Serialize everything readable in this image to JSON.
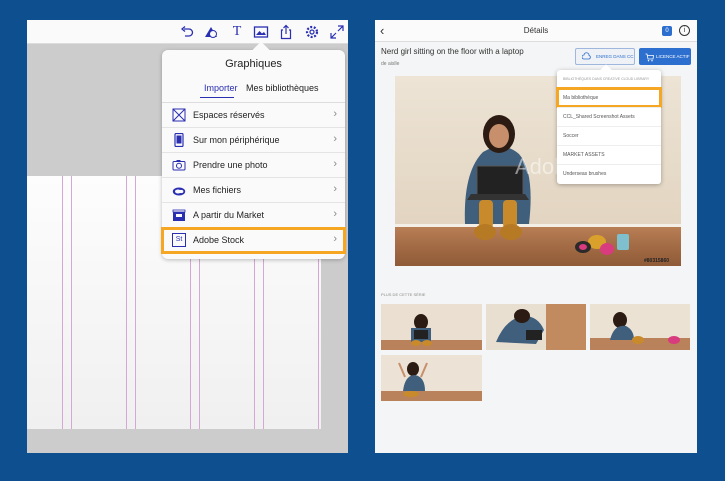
{
  "left_panel": {
    "toolbar": {
      "icons": [
        "undo-icon",
        "shapes-icon",
        "text-icon",
        "image-icon",
        "share-icon",
        "settings-icon",
        "expand-icon"
      ],
      "text_tool_glyph": "T"
    },
    "popover": {
      "title": "Graphiques",
      "segments": [
        "Importer",
        "Mes bibliothèques"
      ],
      "active_segment": "Importer",
      "items": [
        {
          "label": "Espaces réservés",
          "icon": "placeholder-icon"
        },
        {
          "label": "Sur mon périphérique",
          "icon": "device-icon"
        },
        {
          "label": "Prendre une photo",
          "icon": "camera-icon"
        },
        {
          "label": "Mes fichiers",
          "icon": "creative-cloud-icon"
        },
        {
          "label": "A partir du Market",
          "icon": "market-icon"
        },
        {
          "label": "Adobe Stock",
          "icon": "adobe-stock-icon",
          "highlighted": true
        }
      ],
      "stock_icon_text": "St",
      "chevron": "›"
    }
  },
  "right_panel": {
    "nav": {
      "back": "‹",
      "title": "Détails",
      "badge": "0",
      "info": "i"
    },
    "image_title": "Nerd girl sitting on the floor with a laptop",
    "author": "de aislle",
    "save_button": "ENREG DANS CC",
    "license_button": "LICENCE ACTIF",
    "watermark": "Adobe",
    "photo_id": "#80315860",
    "dropdown": {
      "header": "BIBLIOTHÈQUES DANS CREATIVE CLOUD LIBRARY",
      "items": [
        {
          "label": "Ma bibliothèque",
          "highlighted": true
        },
        {
          "label": "CCL_Shared Screenshot Assets"
        },
        {
          "label": "Soccer"
        },
        {
          "label": "MARKET ASSETS"
        },
        {
          "label": "Underseas brushes"
        }
      ]
    },
    "more_label": "PLUS DE CETTE SÉRIE",
    "colors": {
      "accent_blue": "#2d6fcf",
      "highlight_orange": "#f5a623"
    }
  },
  "colors": {
    "background": "#0d4f8f",
    "ui_purple": "#2a2fb2"
  }
}
